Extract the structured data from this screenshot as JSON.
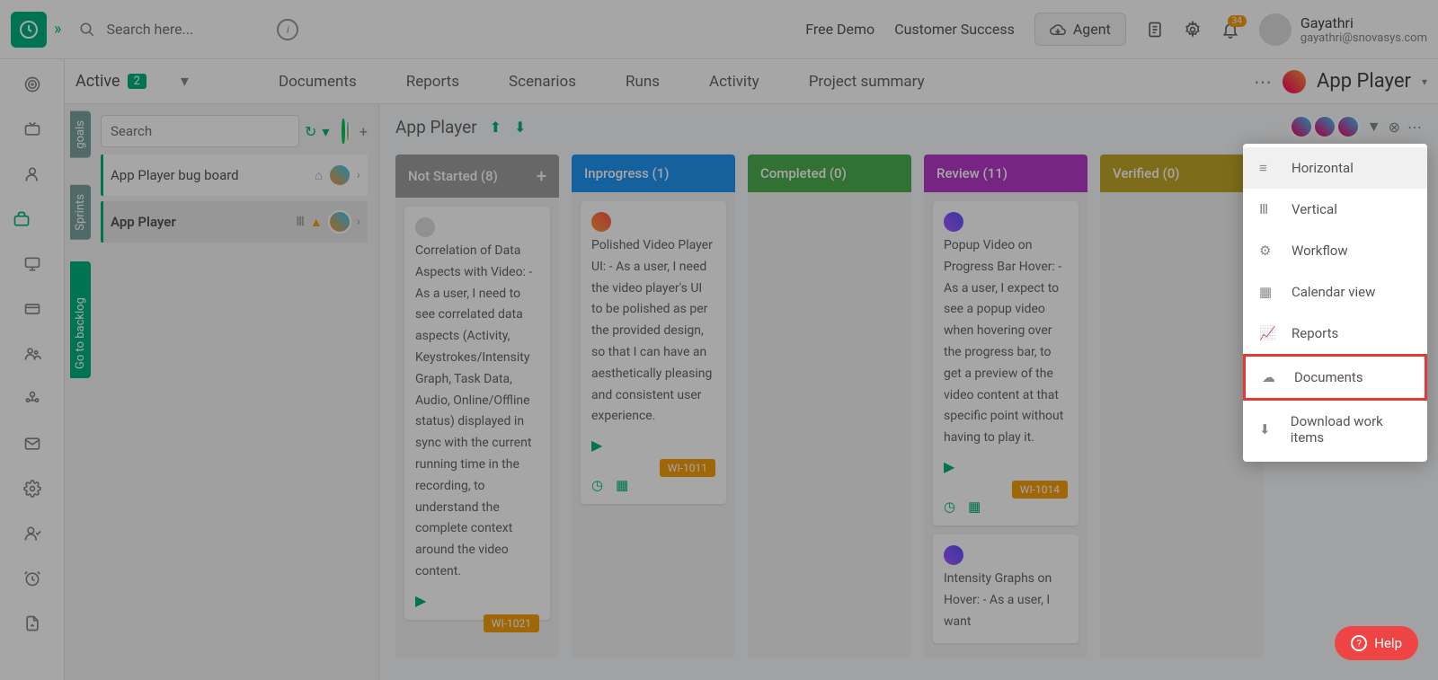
{
  "search": {
    "placeholder": "Search here..."
  },
  "topbar": {
    "free_demo": "Free Demo",
    "customer_success": "Customer Success",
    "agent": "Agent",
    "notif_count": "34",
    "user_name": "Gayathri",
    "user_email": "gayathri@snovasys.com"
  },
  "tabs": {
    "active_label": "Active",
    "active_count": "2",
    "items": [
      "Documents",
      "Reports",
      "Scenarios",
      "Runs",
      "Activity",
      "Project summary"
    ],
    "project": "App Player"
  },
  "side": {
    "vt_goals": "goals",
    "vt_sprints": "Sprints",
    "vt_backlog": "Go to backlog",
    "search_placeholder": "Search",
    "board1": "App Player bug board",
    "board2": "App Player"
  },
  "board": {
    "title": "App Player",
    "cols": {
      "not_started": "Not Started (8)",
      "inprogress": "Inprogress (1)",
      "completed": "Completed (0)",
      "review": "Review (11)",
      "verified": "Verified (0)"
    },
    "cards": {
      "c1": "Correlation of Data Aspects with Video: - As a user, I need to see correlated data aspects (Activity, Keystrokes/Intensity Graph, Task Data, Audio, Online/Offline status) displayed in sync with the current running time in the recording, to understand the complete context around the video content.",
      "c1_tag": "WI-1021",
      "c2": "Polished Video Player UI: - As a user, I need the video player's UI to be polished as per the provided design, so that I can have an aesthetically pleasing and consistent user experience.",
      "c2_tag": "WI-1011",
      "c3": "Popup Video on Progress Bar Hover: - As a user, I expect to see a popup video when hovering over the progress bar, to get a preview of the video content at that specific point without having to play it.",
      "c3_tag": "WI-1014",
      "c4": "Intensity Graphs on Hover: - As a user, I want"
    }
  },
  "dropdown": {
    "horizontal": "Horizontal",
    "vertical": "Vertical",
    "workflow": "Workflow",
    "calendar": "Calendar view",
    "reports": "Reports",
    "documents": "Documents",
    "download": "Download work items"
  },
  "help": "Help"
}
